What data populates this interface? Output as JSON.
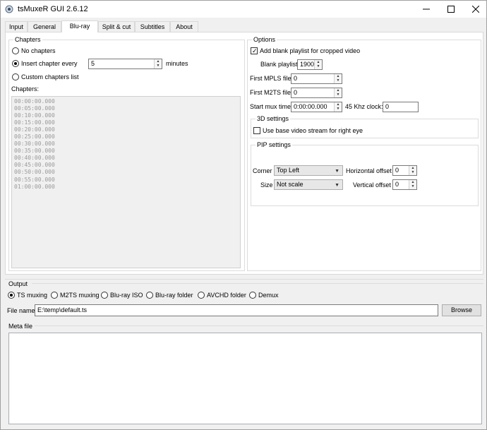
{
  "window": {
    "title": "tsMuxeR GUI 2.6.12"
  },
  "tabs": [
    "Input",
    "General",
    "Blu-ray",
    "Split & cut",
    "Subtitles",
    "About"
  ],
  "chapters": {
    "group_label": "Chapters",
    "no_chapters": "No chapters",
    "insert_every": "Insert chapter every",
    "insert_value": "5",
    "minutes_label": "minutes",
    "custom_list": "Custom chapters list",
    "list_label": "Chapters:",
    "list": [
      "00:00:00.000",
      "00:05:00.000",
      "00:10:00.000",
      "00:15:00.000",
      "00:20:00.000",
      "00:25:00.000",
      "00:30:00.000",
      "00:35:00.000",
      "00:40:00.000",
      "00:45:00.000",
      "00:50:00.000",
      "00:55:00.000",
      "01:00:00.000"
    ]
  },
  "options": {
    "group_label": "Options",
    "add_blank": "Add blank playlist for cropped video",
    "blank_playlist_label": "Blank playlist",
    "blank_playlist_value": "1900",
    "first_mpls_label": "First MPLS file",
    "first_mpls_value": "0",
    "first_m2ts_label": "First M2TS file",
    "first_m2ts_value": "0",
    "start_mux_label": "Start mux time",
    "start_mux_value": "0:00:00.000",
    "clock_label": "45 Khz clock:",
    "clock_value": "0",
    "settings_3d_label": "3D settings",
    "use_base": "Use base video stream for right eye",
    "pip_label": "PIP settings",
    "corner_label": "Corner",
    "corner_value": "Top Left",
    "size_label": "Size",
    "size_value": "Not scale",
    "h_offset_label": "Horizontal offset",
    "h_offset_value": "0",
    "v_offset_label": "Vertical offset",
    "v_offset_value": "0"
  },
  "output": {
    "group_label": "Output",
    "modes": [
      "TS muxing",
      "M2TS muxing",
      "Blu-ray ISO",
      "Blu-ray folder",
      "AVCHD folder",
      "Demux"
    ],
    "file_name_label": "File name",
    "file_name_value": "E:\\temp\\default.ts",
    "browse": "Browse",
    "meta_file_label": "Meta file"
  }
}
